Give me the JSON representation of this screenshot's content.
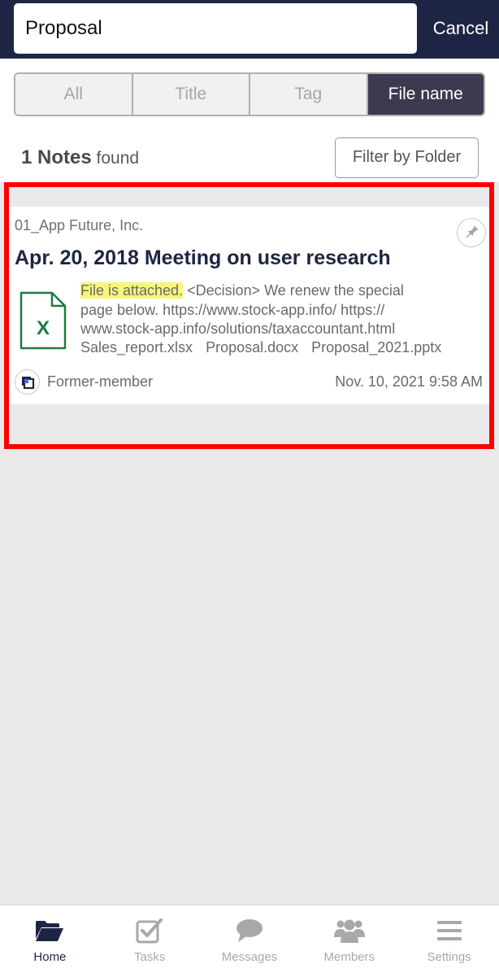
{
  "search": {
    "value": "Proposal",
    "cancel_label": "Cancel"
  },
  "filters": {
    "segments": [
      "All",
      "Title",
      "Tag",
      "File name"
    ],
    "selected": "File name"
  },
  "results": {
    "count": "1 Notes",
    "suffix": "found",
    "filter_button_label": "Filter by Folder"
  },
  "note": {
    "folder": "01_App Future, Inc.",
    "title": "Apr. 20, 2018 Meeting on user research",
    "snippet_highlight": "File is attached.",
    "snippet_line1_rest": " <Decision> We renew the special",
    "snippet_line2": "page below. https://www.stock-app.info/ https://",
    "snippet_line3": "www.stock-app.info/solutions/taxaccountant.html",
    "attachments": [
      "Sales_report.xlsx",
      "Proposal.docx",
      "Proposal_2021.pptx"
    ],
    "file_icon_letter": "X",
    "author": "Former-member",
    "timestamp": "Nov. 10, 2021 9:58 AM"
  },
  "tabs": [
    {
      "label": "Home",
      "icon": "folder-open-icon"
    },
    {
      "label": "Tasks",
      "icon": "checkbox-icon"
    },
    {
      "label": "Messages",
      "icon": "speech-bubble-icon"
    },
    {
      "label": "Members",
      "icon": "people-icon"
    },
    {
      "label": "Settings",
      "icon": "menu-icon"
    }
  ],
  "active_tab": "Home",
  "colors": {
    "navy": "#1e2544",
    "active_segment": "#3b3a4f",
    "excel_green": "#1e7b42",
    "highlight_yellow": "#f6f67a",
    "frame_red": "#ff0000"
  }
}
